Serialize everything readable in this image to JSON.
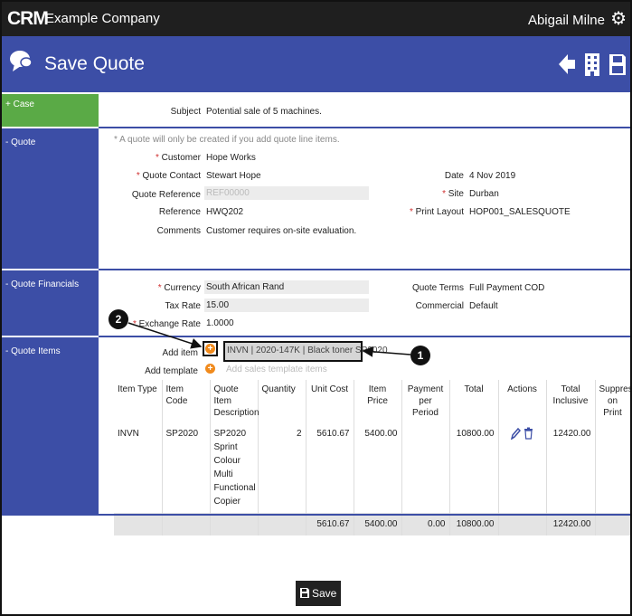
{
  "app": {
    "logo": "CRM",
    "company": "Example Company",
    "user": "Abigail Milne",
    "settings_icon": "gear-icon"
  },
  "page": {
    "title": "Save Quote",
    "icons": [
      "chat-bubble-icon",
      "back-arrow-icon",
      "building-icon",
      "save-disk-icon"
    ]
  },
  "colors": {
    "header_bg": "#3c4ea6",
    "topbar_bg": "#1f1f1f",
    "case_bg": "#5aaa46",
    "required": "#d03030",
    "add_icon": "#f08a1c"
  },
  "sections": {
    "case": {
      "label": "+ Case",
      "subject_label": "Subject",
      "subject_value": "Potential sale of 5 machines."
    },
    "quote": {
      "label": "- Quote",
      "note": "* A quote will only be created if you add quote line items.",
      "customer_label": "Customer",
      "customer_value": "Hope Works",
      "contact_label": "Quote Contact",
      "contact_value": "Stewart Hope",
      "reference_label": "Quote Reference",
      "reference_placeholder": "REF00000",
      "ref_label": "Reference",
      "ref_value": "HWQ202",
      "comments_label": "Comments",
      "comments_value": "Customer requires on-site evaluation.",
      "date_label": "Date",
      "date_value": "4 Nov 2019",
      "site_label": "Site",
      "site_value": "Durban",
      "print_layout_label": "Print Layout",
      "print_layout_value": "HOP001_SALESQUOTE"
    },
    "financials": {
      "label": "- Quote Financials",
      "currency_label": "Currency",
      "currency_value": "South African Rand",
      "tax_rate_label": "Tax Rate",
      "tax_rate_value": "15.00",
      "exchange_rate_label": "Exchange Rate",
      "exchange_rate_value": "1.0000",
      "terms_label": "Quote Terms",
      "terms_value": "Full Payment COD",
      "commercial_label": "Commercial",
      "commercial_value": "Default"
    },
    "items": {
      "label": "- Quote Items",
      "add_item_label": "Add item",
      "add_item_value": "INVN | 2020-147K | Black toner SP2020",
      "add_template_label": "Add template",
      "add_template_placeholder": "Add sales template items",
      "columns": [
        "Item Type",
        "Item Code",
        "Quote Item Description",
        "Quantity",
        "Unit Cost",
        "Item Price",
        "Payment per Period",
        "Total",
        "Actions",
        "Total Inclusive",
        "Suppress on Print"
      ],
      "rows": [
        {
          "type": "INVN",
          "code": "SP2020",
          "description": "SP2020 Sprint Colour Multi Functional Copier",
          "quantity": "2",
          "unit_cost": "5610.67",
          "item_price": "5400.00",
          "payment_per_period": "",
          "total": "10800.00",
          "total_inclusive": "12420.00"
        }
      ],
      "totals": {
        "unit_cost": "5610.67",
        "item_price": "5400.00",
        "payment_per_period": "0.00",
        "total": "10800.00",
        "total_inclusive": "12420.00"
      }
    }
  },
  "callouts": [
    "1",
    "2"
  ],
  "footer": {
    "save_label": "Save"
  }
}
